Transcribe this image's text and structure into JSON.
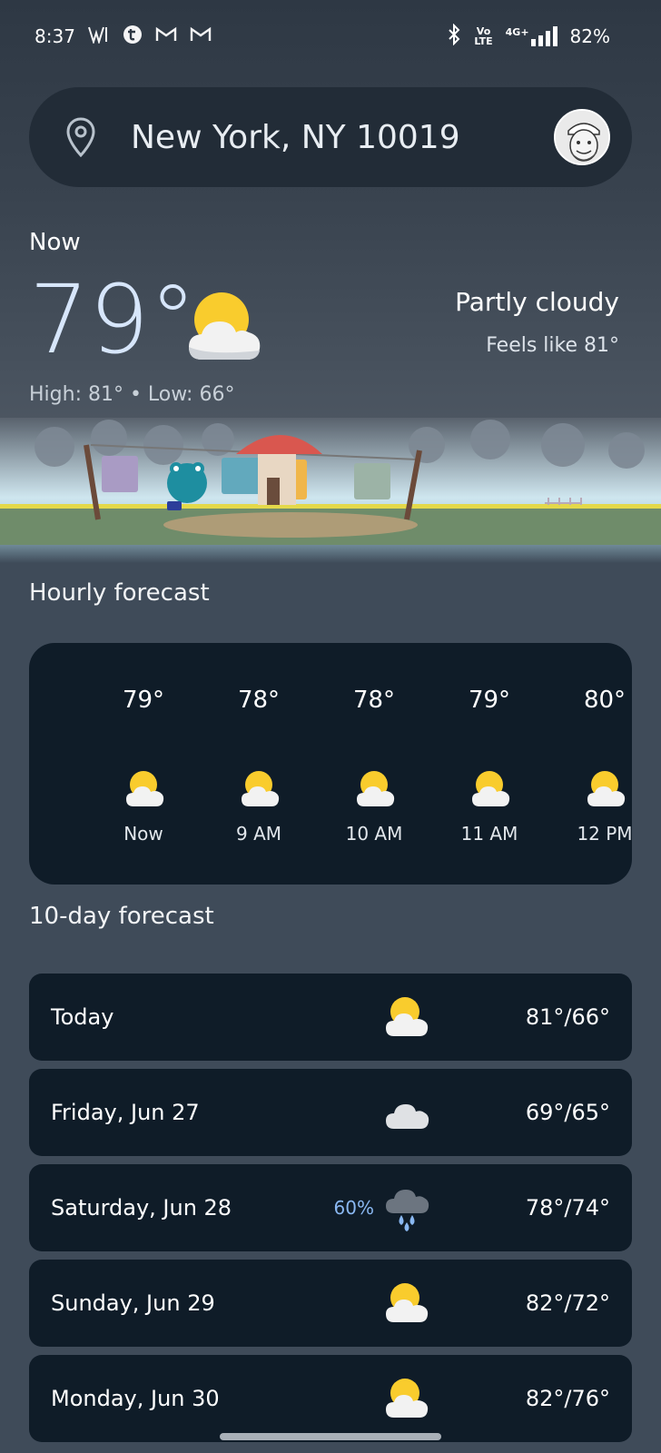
{
  "status_bar": {
    "time": "8:37",
    "left_icons": [
      "w-app-icon",
      "t-app-icon",
      "gmail-icon",
      "gmail-icon"
    ],
    "right_icons": [
      "bluetooth-icon",
      "volte-icon",
      "4g-icon",
      "signal-icon"
    ],
    "volte_label": "Vo\nLTE",
    "network_label": "4G+",
    "battery": "82%"
  },
  "search": {
    "location": "New York, NY 10019"
  },
  "now": {
    "label": "Now",
    "temperature": "79°",
    "high_low": "High: 81° • Low: 66°",
    "condition": "Partly cloudy",
    "feels_like": "Feels like 81°",
    "icon": "partly-cloudy-icon"
  },
  "hourly": {
    "title": "Hourly forecast",
    "items": [
      {
        "temp": "79°",
        "time": "Now",
        "icon": "partly-cloudy-icon"
      },
      {
        "temp": "78°",
        "time": "9 AM",
        "icon": "partly-cloudy-icon"
      },
      {
        "temp": "78°",
        "time": "10 AM",
        "icon": "partly-cloudy-icon"
      },
      {
        "temp": "79°",
        "time": "11 AM",
        "icon": "partly-cloudy-icon"
      },
      {
        "temp": "80°",
        "time": "12 PM",
        "icon": "partly-cloudy-icon"
      }
    ]
  },
  "daily": {
    "title": "10-day forecast",
    "items": [
      {
        "day": "Today",
        "precip": "",
        "temps": "81°/66°",
        "icon": "partly-cloudy-icon"
      },
      {
        "day": "Friday, Jun 27",
        "precip": "",
        "temps": "69°/65°",
        "icon": "cloudy-icon"
      },
      {
        "day": "Saturday, Jun 28",
        "precip": "60%",
        "temps": "78°/74°",
        "icon": "rain-icon"
      },
      {
        "day": "Sunday, Jun 29",
        "precip": "",
        "temps": "82°/72°",
        "icon": "partly-cloudy-icon"
      },
      {
        "day": "Monday, Jun 30",
        "precip": "",
        "temps": "82°/76°",
        "icon": "partly-cloudy-icon"
      }
    ]
  },
  "colors": {
    "card_bg": "#0f1c28",
    "page_bg": "#3f4b59",
    "precip_blue": "#8ab8f2",
    "sun_yellow": "#f9cc2d"
  }
}
